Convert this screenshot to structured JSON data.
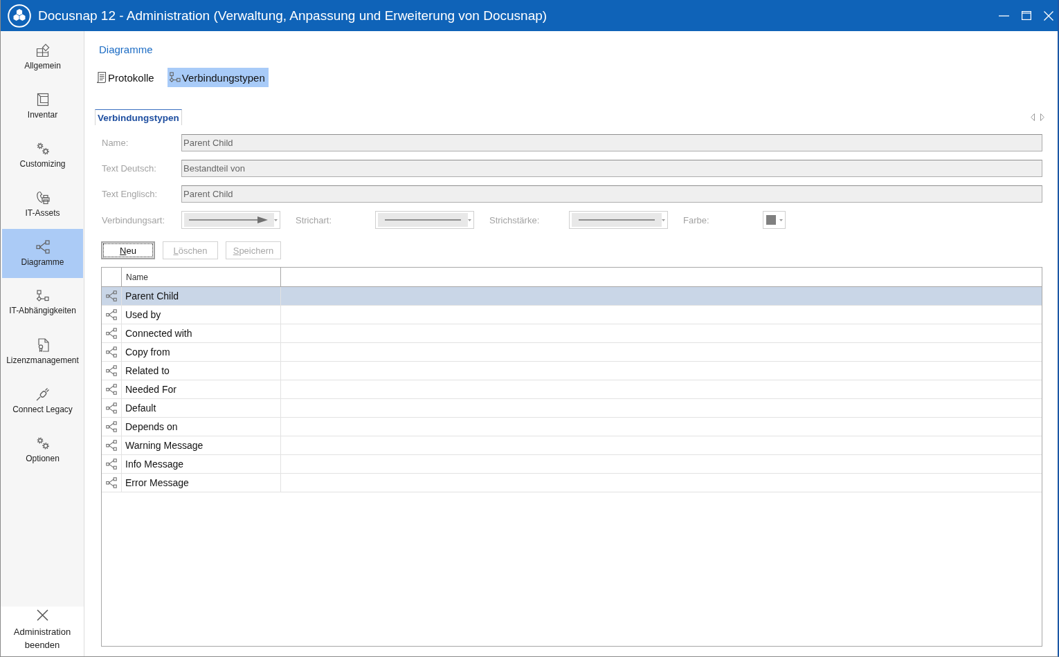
{
  "window": {
    "title": "Docusnap 12 - Administration (Verwaltung, Anpassung und Erweiterung von Docusnap)"
  },
  "sidebar": {
    "items": [
      {
        "label": "Allgemein",
        "selected": false
      },
      {
        "label": "Inventar",
        "selected": false
      },
      {
        "label": "Customizing",
        "selected": false
      },
      {
        "label": "IT-Assets",
        "selected": false
      },
      {
        "label": "Diagramme",
        "selected": true
      },
      {
        "label": "IT-Abhängigkeiten",
        "selected": false
      },
      {
        "label": "Lizenzmanagement",
        "selected": false
      },
      {
        "label": "Connect Legacy",
        "selected": false
      },
      {
        "label": "Optionen",
        "selected": false
      }
    ],
    "exit": {
      "label": "Administration beenden"
    }
  },
  "breadcrumb": {
    "label": "Diagramme"
  },
  "toolbar": {
    "items": [
      {
        "label": "Protokolle",
        "selected": false
      },
      {
        "label": "Verbindungstypen",
        "selected": true
      }
    ]
  },
  "tabs": [
    {
      "label": "Verbindungstypen",
      "selected": true
    }
  ],
  "form": {
    "fields": [
      {
        "label": "Name:",
        "value": "Parent Child",
        "disabled": true
      },
      {
        "label": "Text Deutsch:",
        "value": "Bestandteil von",
        "disabled": true
      },
      {
        "label": "Text Englisch:",
        "value": "Parent Child",
        "disabled": true
      }
    ],
    "pickers": [
      {
        "label": "Verbindungsart:",
        "kind": "arrow",
        "disabled": true
      },
      {
        "label": "Strichart:",
        "kind": "line",
        "disabled": true
      },
      {
        "label": "Strichstärke:",
        "kind": "line",
        "disabled": true
      },
      {
        "label": "Farbe:",
        "kind": "color",
        "color": "#808080",
        "disabled": true
      }
    ]
  },
  "buttons": [
    {
      "label": "Neu",
      "disabled": false,
      "focused": true,
      "mnemonic": true
    },
    {
      "label": "Löschen",
      "disabled": true,
      "focused": false,
      "mnemonic": true
    },
    {
      "label": "Speichern",
      "disabled": true,
      "focused": false,
      "mnemonic": true
    }
  ],
  "table": {
    "columns": [
      "Name"
    ],
    "rows": [
      {
        "name": "Parent Child",
        "selected": true
      },
      {
        "name": "Used by",
        "selected": false
      },
      {
        "name": "Connected with",
        "selected": false
      },
      {
        "name": "Copy from",
        "selected": false
      },
      {
        "name": "Related to",
        "selected": false
      },
      {
        "name": "Needed For",
        "selected": false
      },
      {
        "name": "Default",
        "selected": false
      },
      {
        "name": "Depends on",
        "selected": false
      },
      {
        "name": "Warning Message",
        "selected": false
      },
      {
        "name": "Info Message",
        "selected": false
      },
      {
        "name": "Error Message",
        "selected": false
      }
    ]
  }
}
